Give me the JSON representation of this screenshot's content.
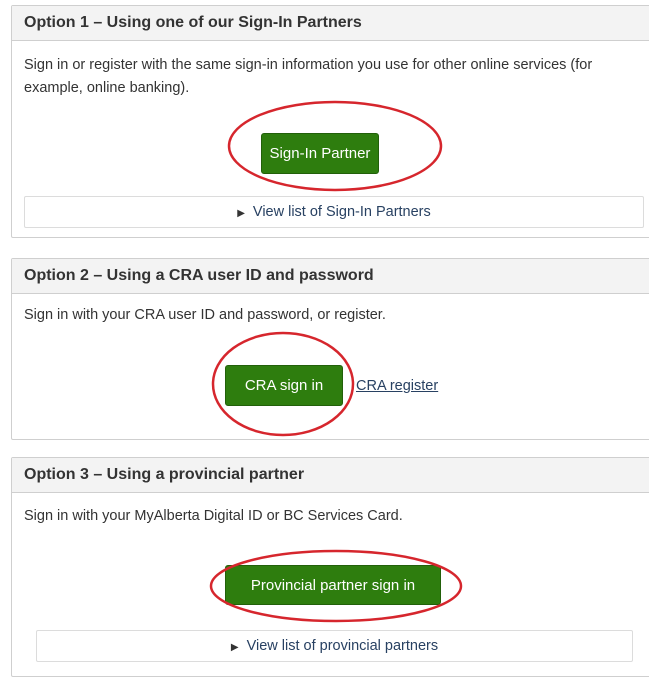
{
  "options": [
    {
      "heading": "Option 1 – Using one of our Sign-In Partners",
      "description": "Sign in or register with the same sign-in information you use for other online services (for example, online banking).",
      "button_label": "Sign-In Partner",
      "details_label": "View list of Sign-In Partners"
    },
    {
      "heading": "Option 2 – Using a CRA user ID and password",
      "description": "Sign in with your CRA user ID and password, or register.",
      "button_label": "CRA sign in",
      "link_label": "CRA register"
    },
    {
      "heading": "Option 3 – Using a provincial partner",
      "description": "Sign in with your MyAlberta Digital ID or BC Services Card.",
      "button_label": "Provincial partner sign in",
      "details_label": "View list of provincial partners"
    }
  ],
  "colors": {
    "button_green": "#2e7d0e",
    "highlight_ring": "#d6262d",
    "link": "#284162"
  },
  "icons": {
    "details_toggle": "triangle-right-icon"
  }
}
